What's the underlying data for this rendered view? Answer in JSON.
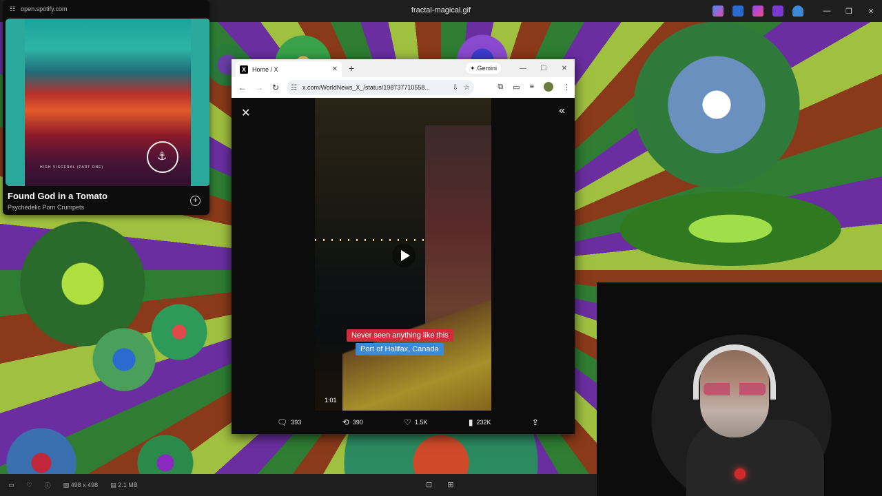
{
  "viewer": {
    "title": "fractal-magical.gif",
    "dimensions": "498 x 498",
    "filesize": "2.1 MB"
  },
  "spotify": {
    "url": "open.spotify.com",
    "track": "Found God in a Tomato",
    "artist": "Psychedelic Porn Crumpets",
    "art_text": "HIGH VISCERAL (PART ONE)"
  },
  "chrome": {
    "tab_title": "Home / X",
    "gemini_label": "Gemini",
    "url": "x.com/WorldNews_X_/status/198737710558..."
  },
  "video": {
    "caption_1": "Never seen anything like this",
    "caption_2": "Port of Halifax, Canada",
    "time": "1:01"
  },
  "actions": {
    "replies": "393",
    "reposts": "390",
    "likes": "1.5K",
    "views": "232K"
  },
  "colors": {
    "caption_1_bg": "#d32a3c",
    "caption_2_bg": "#3a8ad8"
  }
}
